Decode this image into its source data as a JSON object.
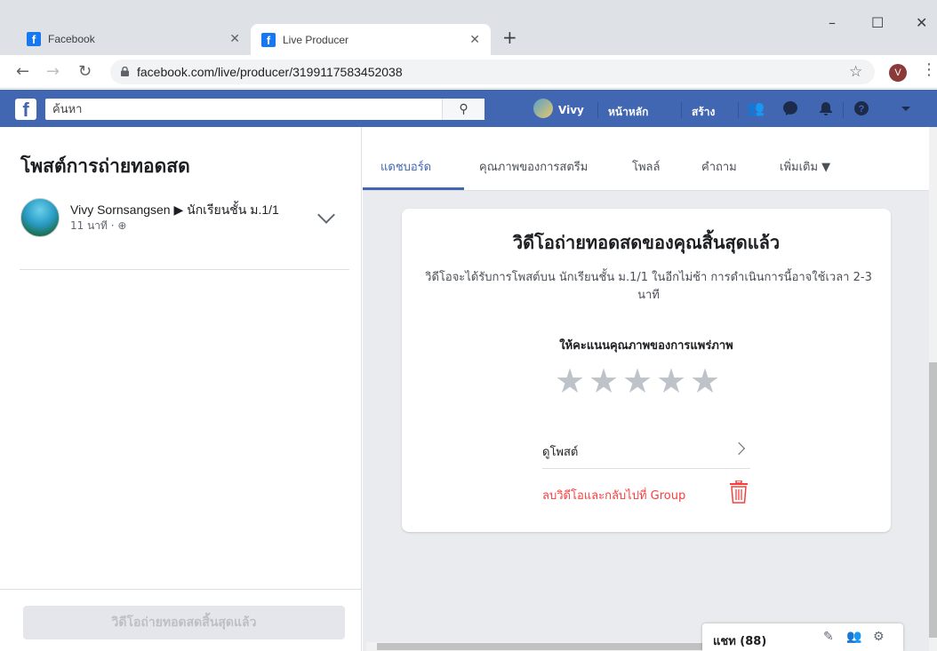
{
  "browser": {
    "tabs": [
      {
        "title": "Facebook",
        "active": false
      },
      {
        "title": "Live Producer",
        "active": true
      }
    ],
    "new_tab_icon": "plus-icon",
    "window_controls": {
      "minimize": "–",
      "maximize": "☐",
      "close": "✕"
    },
    "url": "facebook.com/live/producer/3199117583452038",
    "profile_initial": "V"
  },
  "fb": {
    "logo": "f",
    "search_placeholder": "ค้นหา",
    "user_name": "Vivy",
    "home": "หน้าหลัก",
    "create": "สร้าง",
    "brand_color": "#4267b2"
  },
  "left": {
    "title": "โพสต์การถ่ายทอดสด",
    "post": {
      "author": "Vivy Sornsangsen ▶ นักเรียนชั้น ม.1/1",
      "time": "11 นาที · ⊕"
    },
    "end_button": "วิดีโอถ่ายทอดสดสิ้นสุดแล้ว"
  },
  "tabs": [
    "แดชบอร์ด",
    "คุณภาพของการสตรีม",
    "โพลล์",
    "คำถาม",
    "เพิ่มเติม ▼"
  ],
  "card": {
    "title": "วิดีโอถ่ายทอดสดของคุณสิ้นสุดแล้ว",
    "subtitle": "วิดีโอจะได้รับการโพสต์บน นักเรียนชั้น ม.1/1 ในอีกไม่ช้า การดำเนินการนี้อาจใช้เวลา 2-3 นาที",
    "rate_label": "ให้คะแนนคุณภาพของการแพร่ภาพ",
    "rating": {
      "value": 0,
      "max": 5
    },
    "view_post": "ดูโพสต์",
    "delete_action": "ลบวิดีโอและกลับไปที่ Group"
  },
  "chat": {
    "label": "แชท (88)"
  }
}
